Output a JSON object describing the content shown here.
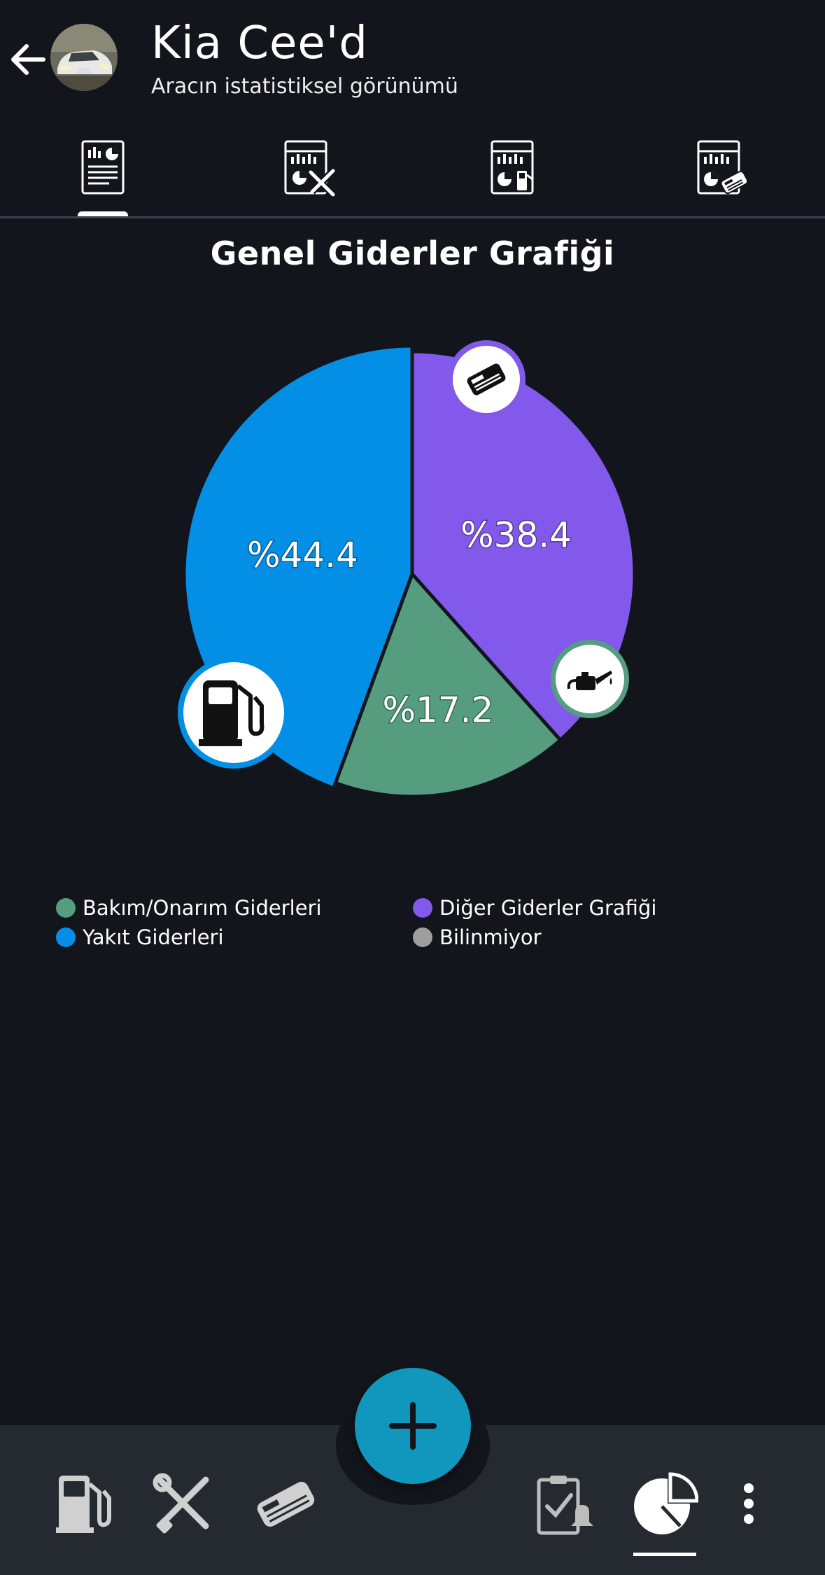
{
  "header": {
    "title": "Kia Cee'd",
    "subtitle": "Aracın istatistiksel görünümü"
  },
  "tabs": [
    {
      "icon": "general-report-icon",
      "active": true
    },
    {
      "icon": "maintenance-chart-icon",
      "active": false
    },
    {
      "icon": "fuel-chart-icon",
      "active": false
    },
    {
      "icon": "other-expenses-chart-icon",
      "active": false
    }
  ],
  "chart_data": {
    "type": "pie",
    "title": "Genel Giderler Grafiği",
    "slices": [
      {
        "name": "Diğer Giderler Grafiği",
        "value": 38.4,
        "label": "%38.4",
        "color": "#8359ec",
        "icon": "card-reader-icon"
      },
      {
        "name": "Bakım/Onarım Giderleri",
        "value": 17.2,
        "label": "%17.2",
        "color": "#569d80",
        "icon": "oil-can-icon"
      },
      {
        "name": "Yakıt Giderleri",
        "value": 44.4,
        "label": "%44.4",
        "color": "#048fe6",
        "icon": "fuel-pump-icon"
      }
    ],
    "legend": [
      {
        "label": "Bakım/Onarım Giderleri",
        "color": "#569d80"
      },
      {
        "label": "Diğer Giderler Grafiği",
        "color": "#8359ec"
      },
      {
        "label": "Yakıt Giderleri",
        "color": "#048fe6"
      },
      {
        "label": "Bilinmiyor",
        "color": "#9e9e9e"
      }
    ]
  },
  "bottom_nav": [
    {
      "icon": "fuel-pump-icon",
      "active": false
    },
    {
      "icon": "tools-icon",
      "active": false
    },
    {
      "icon": "card-reader-icon",
      "active": false
    },
    {
      "icon": "reminder-clipboard-icon",
      "active": false
    },
    {
      "icon": "pie-chart-icon",
      "active": true
    },
    {
      "icon": "more-vertical-icon",
      "active": false
    }
  ],
  "colors": {
    "background": "#12151b",
    "bottom_bar": "#252930",
    "fab": "#1196bd"
  }
}
